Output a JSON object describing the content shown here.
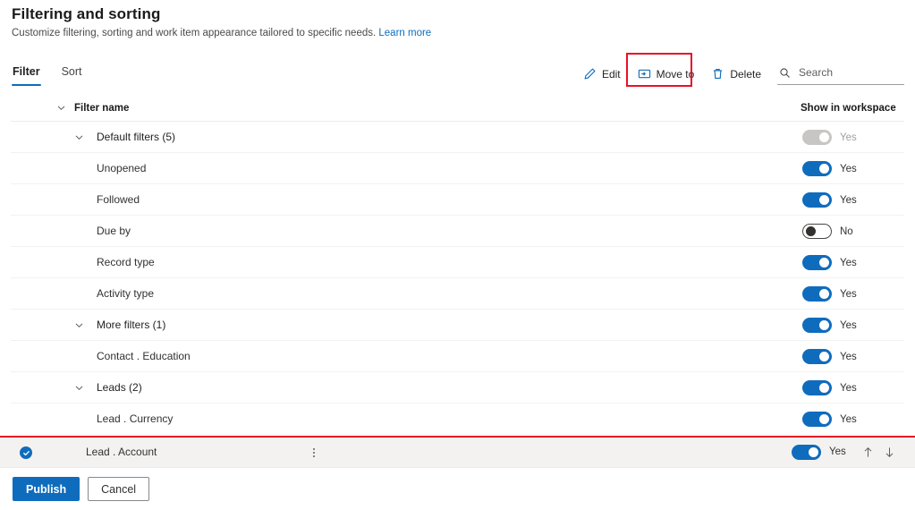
{
  "header": {
    "title": "Filtering and sorting",
    "subtitle": "Customize filtering, sorting and work item appearance tailored to specific needs.",
    "learn_more": "Learn more"
  },
  "tabs": [
    {
      "label": "Filter",
      "selected": true
    },
    {
      "label": "Sort",
      "selected": false
    }
  ],
  "commandbar": {
    "edit": "Edit",
    "move_to": "Move to",
    "delete": "Delete",
    "search_placeholder": "Search",
    "search_value": "",
    "highlight_color": "#e81123"
  },
  "columns": {
    "filter_name": "Filter name",
    "show_in_workspace": "Show in workspace"
  },
  "rows": [
    {
      "label": "Default filters (5)",
      "type": "group",
      "toggle": "disabled",
      "toggle_text": "Yes"
    },
    {
      "label": "Unopened",
      "type": "child",
      "toggle": "on",
      "toggle_text": "Yes"
    },
    {
      "label": "Followed",
      "type": "child",
      "toggle": "on",
      "toggle_text": "Yes"
    },
    {
      "label": "Due by",
      "type": "child",
      "toggle": "off",
      "toggle_text": "No"
    },
    {
      "label": "Record type",
      "type": "child",
      "toggle": "on",
      "toggle_text": "Yes"
    },
    {
      "label": "Activity type",
      "type": "child",
      "toggle": "on",
      "toggle_text": "Yes"
    },
    {
      "label": "More filters (1)",
      "type": "group",
      "toggle": "on",
      "toggle_text": "Yes"
    },
    {
      "label": "Contact . Education",
      "type": "child",
      "toggle": "on",
      "toggle_text": "Yes"
    },
    {
      "label": "Leads (2)",
      "type": "group",
      "toggle": "on",
      "toggle_text": "Yes"
    },
    {
      "label": "Lead . Currency",
      "type": "child",
      "toggle": "on",
      "toggle_text": "Yes"
    }
  ],
  "selected_row": {
    "label": "Lead . Account",
    "toggle": "on",
    "toggle_text": "Yes",
    "selected": true,
    "move_up": "Move up",
    "move_down": "Move down"
  },
  "footer": {
    "publish": "Publish",
    "cancel": "Cancel"
  },
  "theme": {
    "accent": "#0f6cbd",
    "selected_row_bg": "#f3f2f1",
    "highlight": "#e81123"
  }
}
